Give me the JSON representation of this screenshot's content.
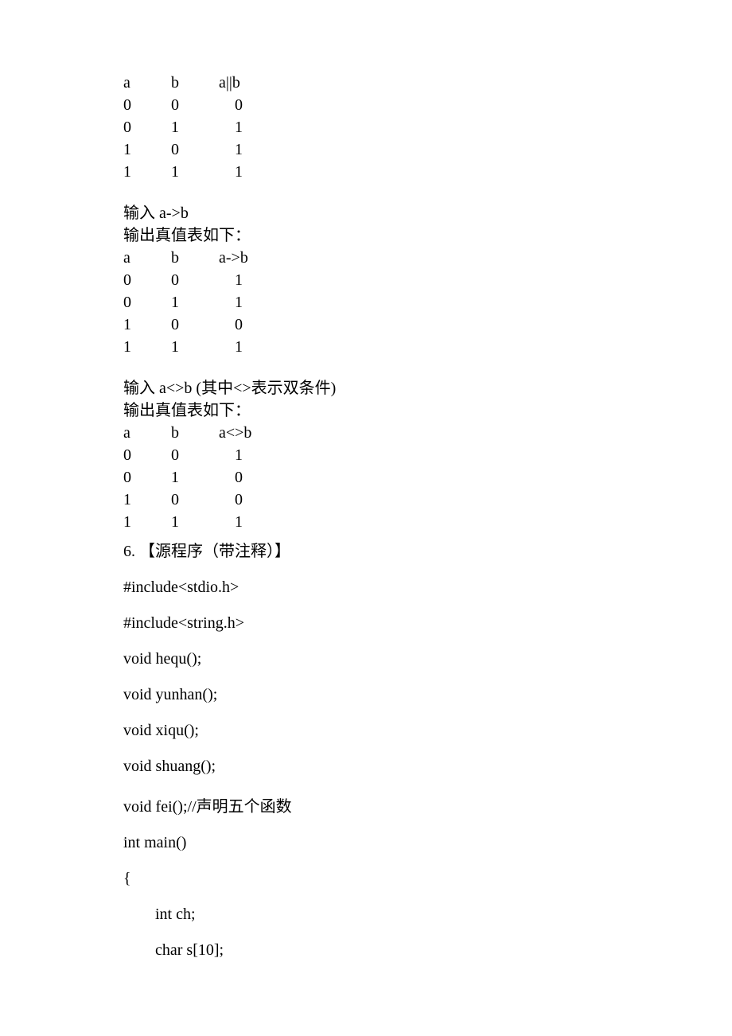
{
  "table_or": {
    "header": {
      "a": "a",
      "b": "b",
      "op": "a||b"
    },
    "rows": [
      {
        "a": "0",
        "b": "0",
        "r": "0"
      },
      {
        "a": "0",
        "b": "1",
        "r": "1"
      },
      {
        "a": "1",
        "b": "0",
        "r": "1"
      },
      {
        "a": "1",
        "b": "1",
        "r": "1"
      }
    ]
  },
  "section_imp": {
    "input": "输入 a->b",
    "output_label": "输出真值表如下：",
    "header": {
      "a": "a",
      "b": "b",
      "op": "a->b"
    },
    "rows": [
      {
        "a": "0",
        "b": "0",
        "r": "1"
      },
      {
        "a": "0",
        "b": "1",
        "r": "1"
      },
      {
        "a": "1",
        "b": "0",
        "r": "0"
      },
      {
        "a": "1",
        "b": "1",
        "r": "1"
      }
    ]
  },
  "section_bicond": {
    "input": "输入 a<>b   (其中<>表示双条件)",
    "output_label": "输出真值表如下：",
    "header": {
      "a": "a",
      "b": "b",
      "op": "a<>b"
    },
    "rows": [
      {
        "a": "0",
        "b": "0",
        "r": "1"
      },
      {
        "a": "0",
        "b": "1",
        "r": "0"
      },
      {
        "a": "1",
        "b": "0",
        "r": "0"
      },
      {
        "a": "1",
        "b": "1",
        "r": "1"
      }
    ]
  },
  "heading_6": "6.   【源程序（带注释）】",
  "code": {
    "l1": "#include<stdio.h>",
    "l2": "#include<string.h>",
    "l3": "void hequ();",
    "l4": "void yunhan();",
    "l5": "void xiqu();",
    "l6": "void shuang();",
    "l7": "void fei();//声明五个函数",
    "l8": "int main()",
    "l9": "{",
    "l10": "int ch;",
    "l11": "char s[10];"
  }
}
